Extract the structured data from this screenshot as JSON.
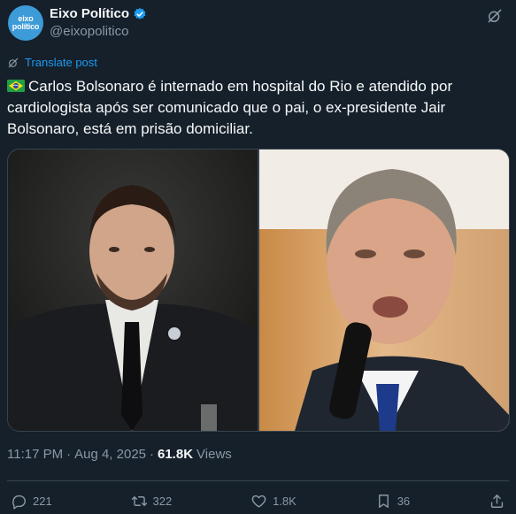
{
  "author": {
    "avatar_text_line1": "eixo",
    "avatar_text_line2": "político",
    "display_name": "Eixo Político",
    "handle": "@eixopolitico"
  },
  "translate_label": "Translate post",
  "post": {
    "flag": "brazil-flag-icon",
    "text": "Carlos Bolsonaro é internado em hospital do Rio e atendido por cardiologista após ser comunicado que o pai, o ex-presidente Jair Bolsonaro, está em prisão domiciliar."
  },
  "meta": {
    "time": "11:17 PM",
    "separator": "·",
    "date": "Aug 4, 2025",
    "views_count": "61.8K",
    "views_label": "Views"
  },
  "actions": {
    "replies": "221",
    "reposts": "322",
    "likes": "1.8K",
    "bookmarks": "36"
  },
  "colors": {
    "background": "#15202b",
    "accent": "#1d9bf0",
    "muted": "#8b98a5",
    "divider": "#38444d"
  }
}
